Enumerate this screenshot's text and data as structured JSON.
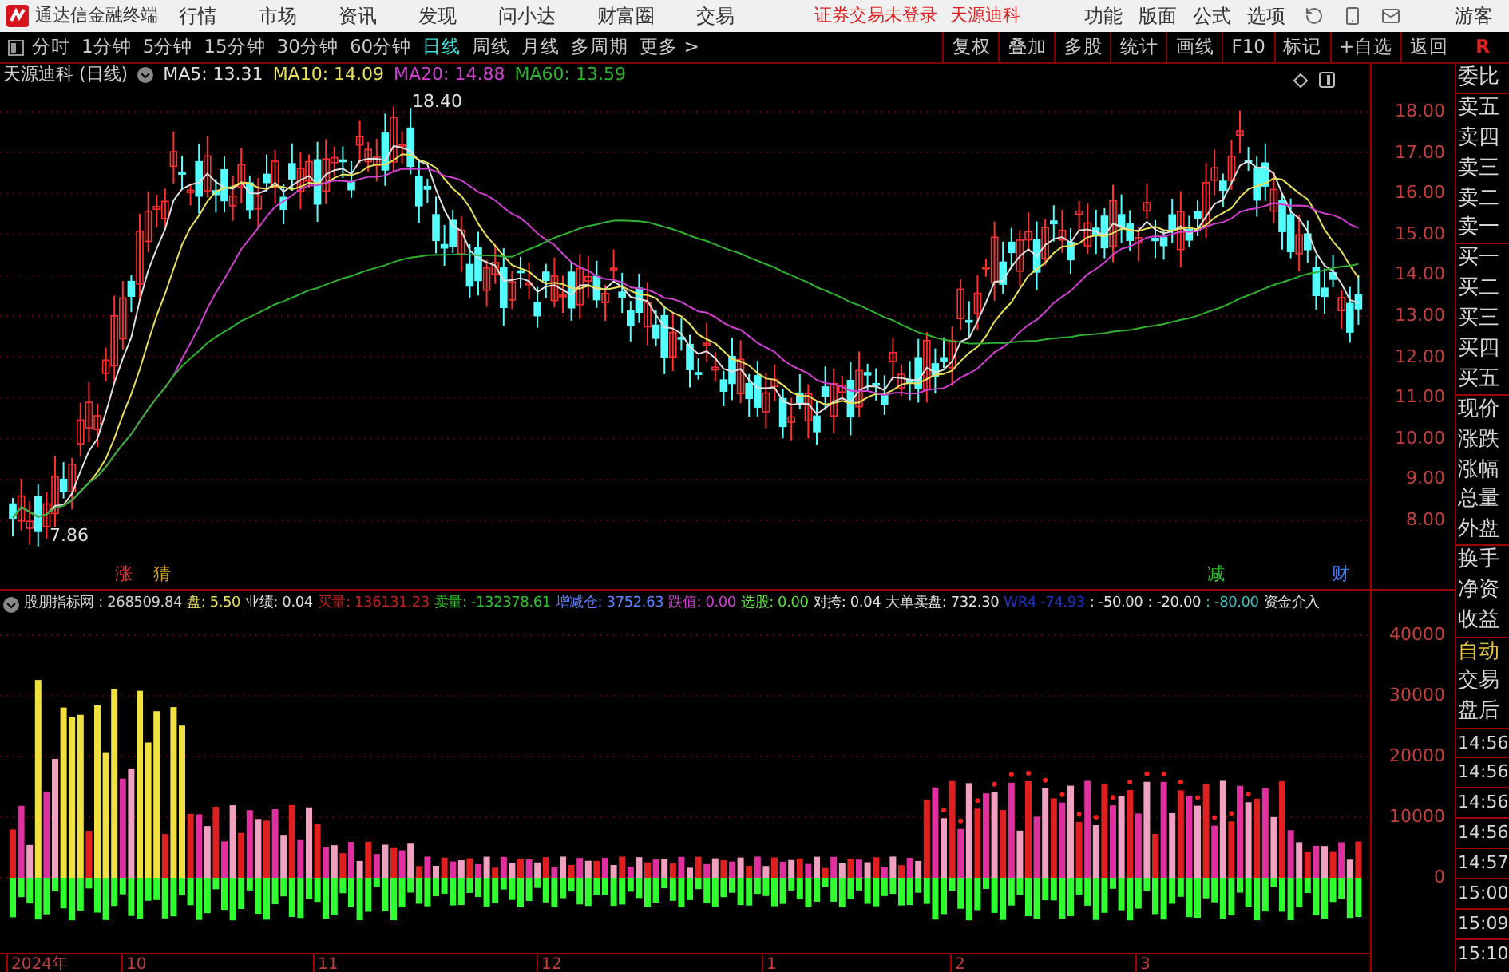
{
  "menu_bar": {
    "app_title": "通达信金融终端",
    "menus": [
      "行情",
      "市场",
      "资讯",
      "发现",
      "问小达",
      "财富圈",
      "交易"
    ],
    "notices": [
      "证券交易未登录",
      "天源迪科"
    ],
    "right_menus": [
      "功能",
      "版面",
      "公式",
      "选项"
    ],
    "user": "游客"
  },
  "period_tabs": [
    {
      "label": "分时",
      "selected": false
    },
    {
      "label": "1分钟",
      "selected": false
    },
    {
      "label": "5分钟",
      "selected": false
    },
    {
      "label": "15分钟",
      "selected": false
    },
    {
      "label": "30分钟",
      "selected": false
    },
    {
      "label": "60分钟",
      "selected": false
    },
    {
      "label": "日线",
      "selected": true
    },
    {
      "label": "周线",
      "selected": false
    },
    {
      "label": "月线",
      "selected": false
    },
    {
      "label": "多周期",
      "selected": false
    },
    {
      "label": "更多 >",
      "selected": false
    }
  ],
  "tools": [
    "复权",
    "叠加",
    "多股",
    "统计",
    "画线",
    "F10",
    "标记",
    "+自选",
    "返回"
  ],
  "tool_flag": "R",
  "chart": {
    "title": "天源迪科 (日线)",
    "ma": [
      {
        "label": "MA5: 13.31",
        "color": "#e0e0e0"
      },
      {
        "label": "MA10: 14.09",
        "color": "#e8e05a"
      },
      {
        "label": "MA20: 14.88",
        "color": "#d040d0"
      },
      {
        "label": "MA60: 13.59",
        "color": "#30b030"
      }
    ],
    "high_label": "18.40",
    "low_label": "7.86",
    "price_ticks": [
      "18.00",
      "17.00",
      "16.00",
      "15.00",
      "14.00",
      "13.00",
      "12.00",
      "11.00",
      "10.00",
      "9.00",
      "8.00"
    ],
    "events": [
      {
        "label": "涨",
        "color": "#e03030"
      },
      {
        "label": "猜",
        "color": "#d0a020"
      },
      {
        "label": "减",
        "color": "#30c030"
      },
      {
        "label": "财",
        "color": "#4080ff"
      }
    ]
  },
  "indicator": {
    "items": [
      {
        "text": "股朋指标网 : 268509.84",
        "color": "#d0d0d0"
      },
      {
        "text": "盘: 5.50",
        "color": "#e8e05a"
      },
      {
        "text": "业绩: 0.04",
        "color": "#e0e0e0"
      },
      {
        "text": "买量: 136131.23",
        "color": "#c02020"
      },
      {
        "text": "卖量: -132378.61",
        "color": "#30c030"
      },
      {
        "text": "增减仓: 3752.63",
        "color": "#6080ff"
      },
      {
        "text": "跌值: 0.00",
        "color": "#d040d0"
      },
      {
        "text": "选股: 0.00",
        "color": "#60e040"
      },
      {
        "text": "对挎: 0.04",
        "color": "#e0e0e0"
      },
      {
        "text": "大单卖盘: 732.30",
        "color": "#e0e0e0"
      },
      {
        "text": "WR4 -74.93",
        "color": "#2030c0"
      },
      {
        "text": ": -50.00",
        "color": "#e0e0e0"
      },
      {
        "text": ": -20.00",
        "color": "#e0e0e0"
      },
      {
        "text": ": -80.00",
        "color": "#40c0c0"
      },
      {
        "text": "资金介入",
        "color": "#e0e0e0"
      }
    ],
    "ticks": [
      "40000",
      "30000",
      "20000",
      "10000",
      "0"
    ]
  },
  "date_axis": [
    "2024年",
    "10",
    "11",
    "12",
    "1",
    "2",
    "3"
  ],
  "side_panel": {
    "quote_labels": [
      "委比",
      "卖五",
      "卖四",
      "卖三",
      "卖二",
      "卖一",
      "买一",
      "买二",
      "买三",
      "买四",
      "买五",
      "现价",
      "涨跌",
      "涨幅",
      "总量",
      "外盘",
      "换手",
      "净资",
      "收益"
    ],
    "mode": "自动",
    "extra": [
      "交易",
      "盘后"
    ],
    "times": [
      "14:56",
      "14:56",
      "14:56",
      "14:56",
      "14:57",
      "15:00",
      "15:09",
      "15:10"
    ]
  }
}
